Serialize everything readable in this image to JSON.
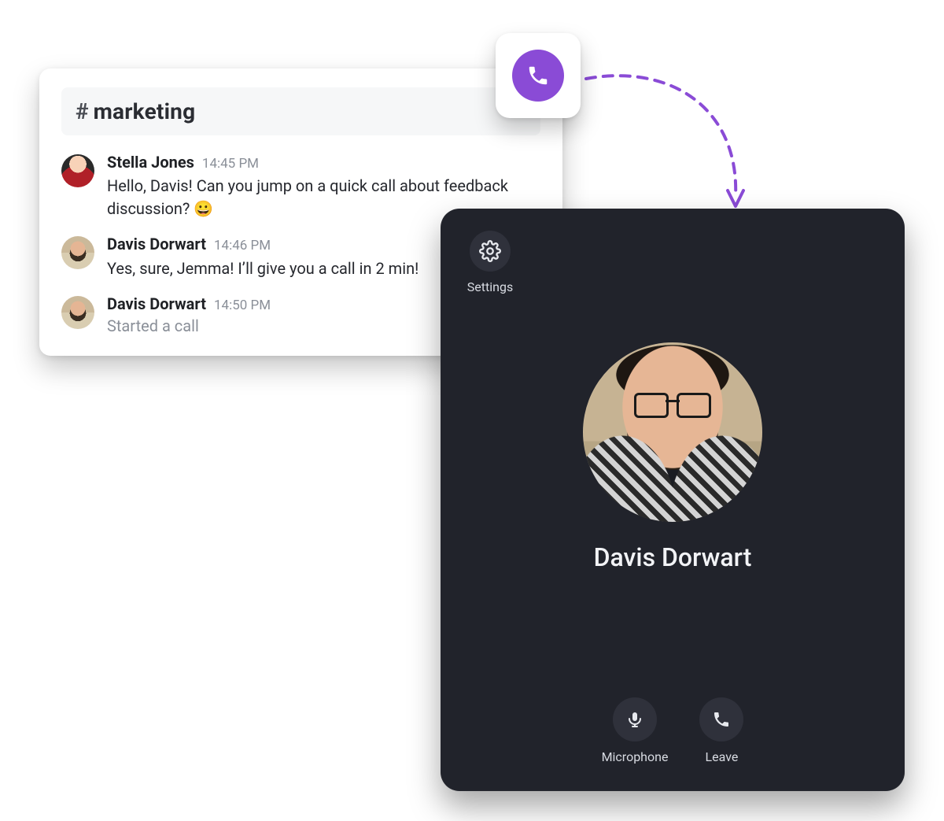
{
  "chat": {
    "channel_name": "marketing",
    "messages": [
      {
        "author": "Stella Jones",
        "time": "14:45 PM",
        "text": "Hello, Davis! Can you jump on a quick call about feedback discussion? 😀"
      },
      {
        "author": "Davis Dorwart",
        "time": "14:46 PM",
        "text": "Yes, sure, Jemma! I’ll give you a call in 2 min!"
      },
      {
        "author": "Davis Dorwart",
        "time": "14:50 PM",
        "status": "Started a call"
      }
    ]
  },
  "call": {
    "settings_label": "Settings",
    "caller_name": "Davis Dorwart",
    "controls": {
      "microphone": "Microphone",
      "leave": "Leave"
    }
  },
  "colors": {
    "phone_accent": "#8a4bd6"
  }
}
